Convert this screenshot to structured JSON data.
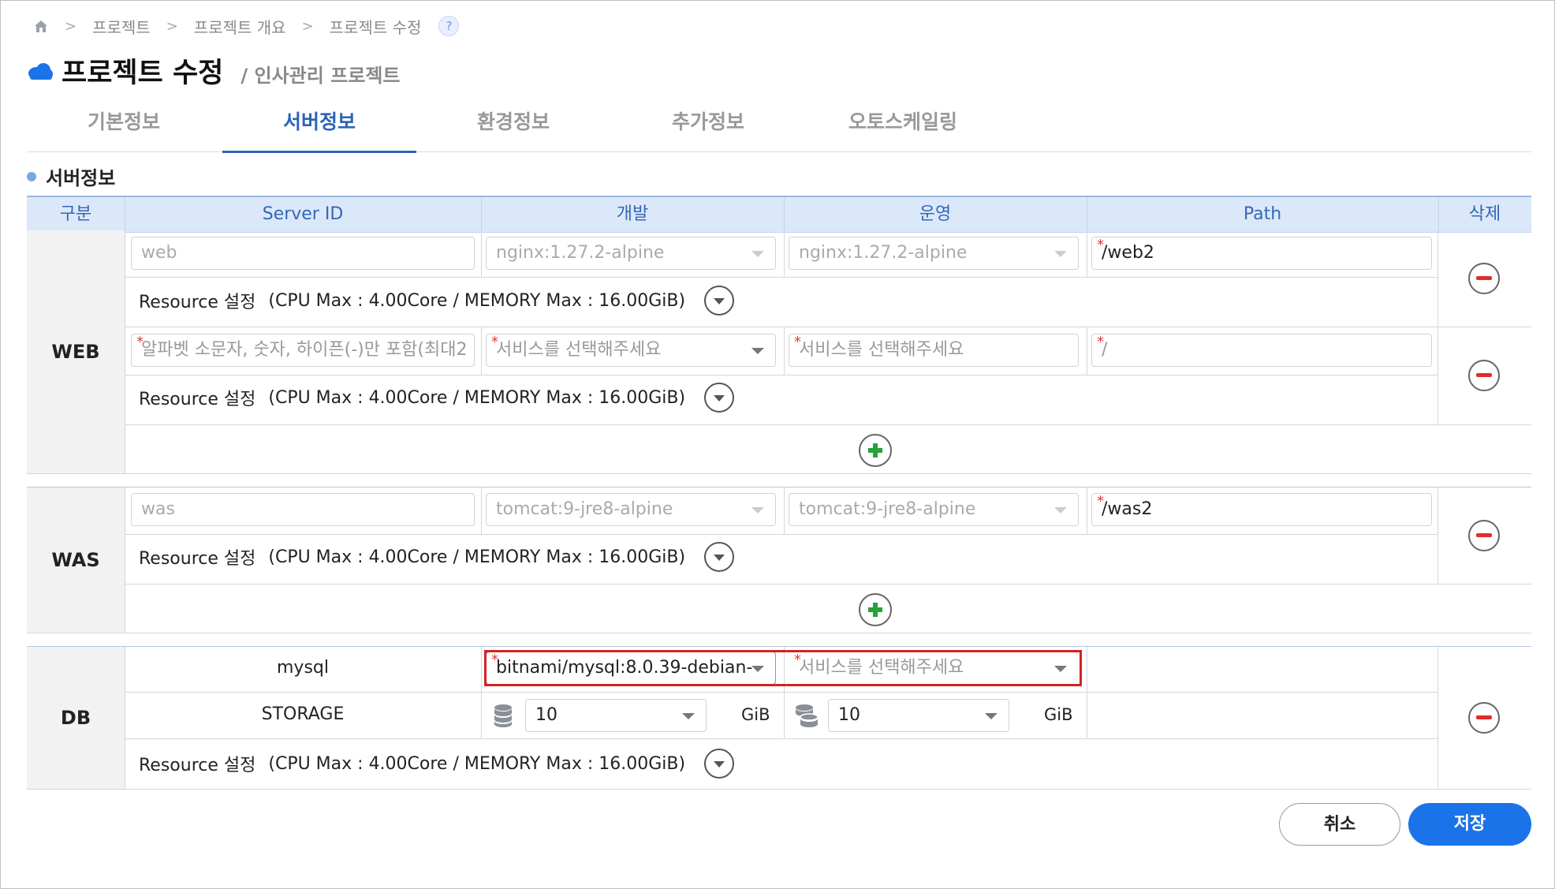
{
  "breadcrumb": {
    "items": [
      "프로젝트",
      "프로젝트 개요",
      "프로젝트 수정"
    ],
    "help": "?"
  },
  "header": {
    "title": "프로젝트 수정",
    "subtitle": "/ 인사관리 프로젝트"
  },
  "tabs": [
    {
      "label": "기본정보"
    },
    {
      "label": "서버정보",
      "active": true
    },
    {
      "label": "환경정보"
    },
    {
      "label": "추가정보"
    },
    {
      "label": "오토스케일링"
    }
  ],
  "section": {
    "title": "서버정보"
  },
  "table": {
    "headers": [
      "구분",
      "Server ID",
      "개발",
      "운영",
      "Path",
      "삭제"
    ]
  },
  "resource_text": "Resource 설정",
  "resource_spec": "(CPU Max : 4.00Core / MEMORY Max : 16.00GiB)",
  "web": {
    "label": "WEB",
    "row1": {
      "server_id": "web",
      "dev": "nginx:1.27.2-alpine",
      "prod": "nginx:1.27.2-alpine",
      "path": "/web2"
    },
    "row2": {
      "server_id_placeholder": "알파벳 소문자, 숫자, 하이픈(-)만 포함(최대2",
      "dev_placeholder": "서비스를 선택해주세요",
      "prod_placeholder": "서비스를 선택해주세요",
      "path_placeholder": "/"
    }
  },
  "was": {
    "label": "WAS",
    "row1": {
      "server_id": "was",
      "dev": "tomcat:9-jre8-alpine",
      "prod": "tomcat:9-jre8-alpine",
      "path": "/was2"
    }
  },
  "db": {
    "label": "DB",
    "server_id": "mysql",
    "dev": "bitnami/mysql:8.0.39-debian-",
    "prod_placeholder": "서비스를 선택해주세요",
    "storage_label": "STORAGE",
    "dev_storage": "10",
    "prod_storage": "10",
    "unit": "GiB"
  },
  "buttons": {
    "cancel": "취소",
    "save": "저장"
  },
  "colors": {
    "accent": "#1a73e8",
    "tab_active": "#2d63b8",
    "header_bg": "#dbe8fa",
    "required": "#e23a3a",
    "highlight": "#d42323"
  }
}
